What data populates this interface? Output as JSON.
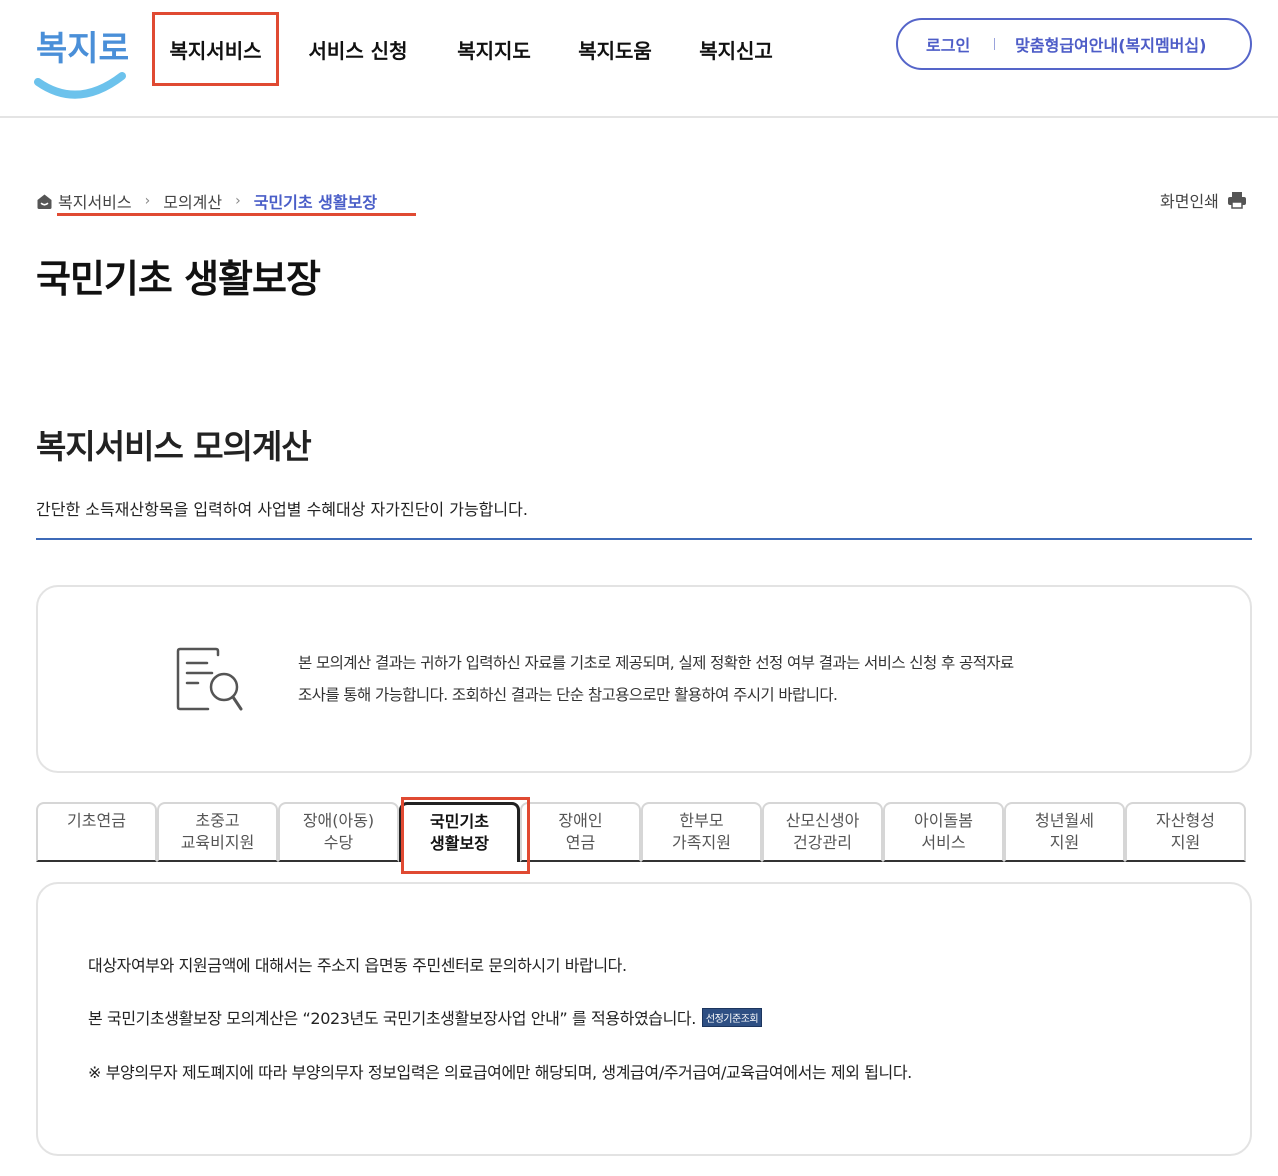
{
  "header": {
    "logo_text": "복지로",
    "nav": [
      {
        "label": "복지서비스",
        "active": true
      },
      {
        "label": "서비스 신청",
        "active": false
      },
      {
        "label": "복지지도",
        "active": false
      },
      {
        "label": "복지도움",
        "active": false
      },
      {
        "label": "복지신고",
        "active": false
      }
    ],
    "login_label": "로그인",
    "membership_label": "맞춤형급여안내(복지멤버십)"
  },
  "breadcrumb": {
    "items": [
      "복지서비스",
      "모의계산",
      "국민기초 생활보장"
    ]
  },
  "print_label": "화면인쇄",
  "page_title": "국민기초 생활보장",
  "section": {
    "title": "복지서비스 모의계산",
    "description": "간단한 소득재산항목을 입력하여 사업별 수혜대상 자가진단이 가능합니다."
  },
  "notice": {
    "line1": "본 모의계산 결과는 귀하가 입력하신 자료를 기초로 제공되며, 실제 정확한 선정 여부 결과는 서비스 신청 후 공적자료",
    "line2": "조사를 통해 가능합니다. 조회하신 결과는 단순 참고용으로만 활용하여 주시기 바랍니다."
  },
  "tabs": [
    {
      "line1": "기초연금",
      "line2": "",
      "active": false
    },
    {
      "line1": "초중고",
      "line2": "교육비지원",
      "active": false
    },
    {
      "line1": "장애(아동)",
      "line2": "수당",
      "active": false
    },
    {
      "line1": "국민기초",
      "line2": "생활보장",
      "active": true
    },
    {
      "line1": "장애인",
      "line2": "연금",
      "active": false
    },
    {
      "line1": "한부모",
      "line2": "가족지원",
      "active": false
    },
    {
      "line1": "산모신생아",
      "line2": "건강관리",
      "active": false
    },
    {
      "line1": "아이돌봄",
      "line2": "서비스",
      "active": false
    },
    {
      "line1": "청년월세",
      "line2": "지원",
      "active": false
    },
    {
      "line1": "자산형성",
      "line2": "지원",
      "active": false
    }
  ],
  "info": {
    "line1": "대상자여부와 지원금액에 대해서는 주소지 읍면동 주민센터로 문의하시기 바랍니다.",
    "line2": "본 국민기초생활보장 모의계산은 “2023년도 국민기초생활보장사업 안내” 를 적용하였습니다.",
    "criteria_button": "선정기준조회",
    "line3": "※ 부양의무자 제도폐지에 따라 부양의무자 정보입력은 의료급여에만 해당되며, 생계급여/주거급여/교육급여에서는 제외 됩니다."
  },
  "colors": {
    "accent_blue": "#4d5cc7",
    "highlight_red": "#e04a32",
    "section_line": "#3e6ab8"
  }
}
